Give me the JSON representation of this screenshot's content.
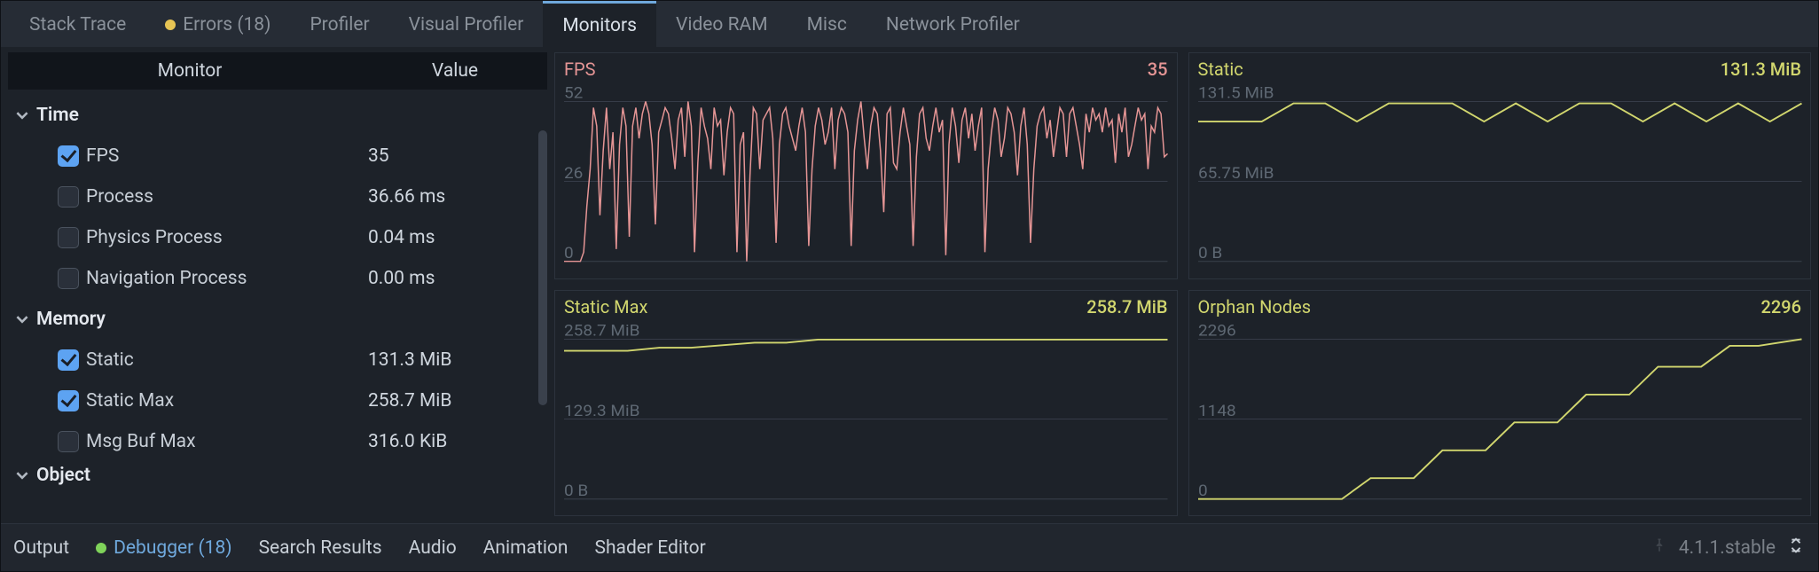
{
  "top_tabs": {
    "stack_trace": "Stack Trace",
    "errors": "Errors (18)",
    "profiler": "Profiler",
    "visual_profiler": "Visual Profiler",
    "monitors": "Monitors",
    "video_ram": "Video RAM",
    "misc": "Misc",
    "network_profiler": "Network Profiler"
  },
  "mon_list": {
    "header_monitor": "Monitor",
    "header_value": "Value",
    "groups": [
      {
        "name": "Time",
        "items": [
          {
            "label": "FPS",
            "value": "35",
            "checked": true
          },
          {
            "label": "Process",
            "value": "36.66 ms",
            "checked": false
          },
          {
            "label": "Physics Process",
            "value": "0.04 ms",
            "checked": false
          },
          {
            "label": "Navigation Process",
            "value": "0.00 ms",
            "checked": false
          }
        ]
      },
      {
        "name": "Memory",
        "items": [
          {
            "label": "Static",
            "value": "131.3 MiB",
            "checked": true
          },
          {
            "label": "Static Max",
            "value": "258.7 MiB",
            "checked": true
          },
          {
            "label": "Msg Buf Max",
            "value": "316.0 KiB",
            "checked": false
          }
        ]
      },
      {
        "name": "Object",
        "items": []
      }
    ]
  },
  "chart_data": [
    {
      "id": "fps",
      "type": "line",
      "title": "FPS",
      "value_label": "35",
      "color": "#e59595",
      "ylim": [
        0,
        52
      ],
      "yticks": [
        "52",
        "26",
        "0"
      ],
      "x": [
        160,
        162,
        164,
        166,
        168,
        170,
        172,
        174,
        176,
        178,
        180,
        182,
        184,
        186,
        188,
        190,
        192,
        194,
        196,
        198,
        200,
        202,
        204,
        206,
        208,
        210,
        212,
        214,
        216,
        218,
        220,
        222,
        224,
        226,
        228,
        230,
        232,
        234,
        236,
        238,
        240,
        242,
        244,
        246,
        248,
        250,
        252,
        254,
        256,
        258,
        260,
        262,
        264,
        266,
        268,
        270,
        272,
        274,
        276,
        278,
        280,
        282,
        284,
        286,
        288,
        290,
        292,
        294,
        296,
        298,
        300,
        302,
        304,
        306,
        308,
        310,
        312,
        314,
        316,
        318,
        320,
        322,
        324,
        326,
        328,
        330,
        332,
        334,
        336,
        338,
        340,
        342,
        344,
        346,
        348,
        350,
        352,
        354,
        356,
        358,
        360,
        362,
        364,
        366,
        368,
        370,
        372,
        374,
        376,
        378,
        380,
        382,
        384,
        386,
        388,
        390,
        392,
        394,
        396,
        398,
        400,
        402,
        404,
        406,
        408,
        410,
        412,
        414,
        416,
        418,
        420,
        422,
        424,
        426,
        428,
        430,
        432,
        434,
        436,
        438,
        440,
        442,
        444,
        446,
        448,
        450,
        452,
        454,
        456,
        458,
        460,
        462,
        464,
        466,
        468,
        470,
        472,
        474,
        476,
        478,
        480,
        482,
        484,
        486,
        488,
        490,
        492,
        494,
        496,
        498,
        500,
        502,
        504,
        506,
        508,
        510,
        512,
        514,
        516,
        518,
        520,
        522,
        524,
        526,
        528,
        530
      ],
      "values": [
        0,
        0,
        0,
        0,
        0,
        0,
        3,
        18,
        30,
        50,
        44,
        15,
        36,
        50,
        30,
        42,
        4,
        38,
        50,
        44,
        8,
        44,
        50,
        40,
        48,
        52,
        48,
        38,
        12,
        42,
        46,
        50,
        48,
        40,
        30,
        46,
        50,
        34,
        52,
        44,
        3,
        32,
        50,
        44,
        40,
        30,
        50,
        44,
        46,
        28,
        42,
        50,
        48,
        3,
        38,
        42,
        0,
        28,
        50,
        48,
        30,
        46,
        48,
        50,
        40,
        6,
        38,
        48,
        50,
        44,
        40,
        36,
        44,
        50,
        42,
        5,
        30,
        44,
        50,
        46,
        38,
        42,
        50,
        30,
        46,
        50,
        48,
        42,
        5,
        36,
        46,
        52,
        40,
        30,
        44,
        50,
        48,
        36,
        16,
        48,
        50,
        32,
        30,
        42,
        50,
        44,
        38,
        5,
        34,
        48,
        50,
        40,
        36,
        44,
        50,
        42,
        46,
        2,
        38,
        50,
        44,
        32,
        46,
        50,
        40,
        48,
        36,
        44,
        50,
        3,
        30,
        42,
        50,
        46,
        34,
        40,
        50,
        48,
        42,
        28,
        44,
        50,
        38,
        6,
        30,
        44,
        48,
        50,
        40,
        46,
        34,
        42,
        50,
        48,
        34,
        48,
        50,
        44,
        38,
        30,
        48,
        42,
        50,
        46,
        48,
        42,
        50,
        44,
        46,
        32,
        48,
        42,
        50,
        34,
        38,
        44,
        50,
        46,
        48,
        30,
        44,
        42,
        50,
        48,
        34,
        35
      ]
    },
    {
      "id": "static",
      "type": "line",
      "title": "Static",
      "value_label": "131.3 MiB",
      "color": "#d1d66e",
      "ylim": [
        0,
        131.5
      ],
      "yticks": [
        "131.5 MiB",
        "65.75 MiB",
        "0 B"
      ],
      "x": [
        140,
        160,
        180,
        200,
        220,
        240,
        260,
        280,
        300,
        320,
        340,
        360,
        380,
        400,
        420,
        440,
        460,
        480,
        500,
        520
      ],
      "values": [
        115,
        115,
        115,
        130,
        130,
        115,
        130,
        130,
        130,
        115,
        130,
        115,
        130,
        130,
        115,
        130,
        115,
        130,
        115,
        130
      ]
    },
    {
      "id": "static_max",
      "type": "line",
      "title": "Static Max",
      "value_label": "258.7 MiB",
      "color": "#d1d66e",
      "ylim": [
        0,
        258.7
      ],
      "yticks": [
        "258.7 MiB",
        "129.3 MiB",
        "0 B"
      ],
      "x": [
        140,
        180,
        200,
        220,
        260,
        280,
        300,
        520
      ],
      "values": [
        240,
        240,
        245,
        245,
        253,
        253,
        258,
        258
      ]
    },
    {
      "id": "orphan_nodes",
      "type": "line",
      "title": "Orphan Nodes",
      "value_label": "2296",
      "color": "#d1d66e",
      "ylim": [
        0,
        2296
      ],
      "yticks": [
        "2296",
        "1148",
        "0"
      ],
      "x": [
        100,
        200,
        220,
        250,
        270,
        300,
        320,
        350,
        370,
        400,
        420,
        450,
        470,
        490,
        520
      ],
      "values": [
        0,
        0,
        300,
        300,
        700,
        700,
        1100,
        1100,
        1500,
        1500,
        1900,
        1900,
        2200,
        2200,
        2296
      ]
    }
  ],
  "colors": {
    "fps": "#e59595",
    "mem": "#d1d66e"
  },
  "bottom_bar": {
    "output": "Output",
    "debugger": "Debugger (18)",
    "search_results": "Search Results",
    "audio": "Audio",
    "animation": "Animation",
    "shader_editor": "Shader Editor",
    "version": "4.1.1.stable"
  }
}
